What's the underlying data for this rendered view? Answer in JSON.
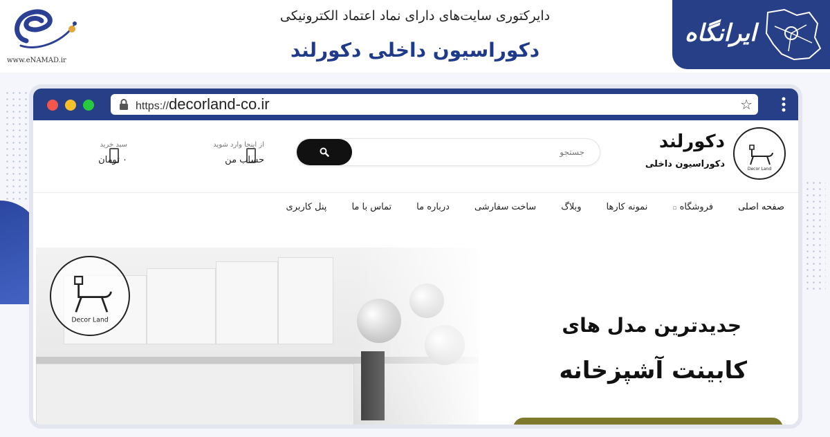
{
  "banner": {
    "enamad_url": "www.eNAMAD.ir",
    "directory_title": "دایرکتوری سایت‌های دارای نماد اعتماد الکترونیکی",
    "site_title": "دکوراسیون داخلی دکورلند",
    "irangah_label": "ایرانگاه"
  },
  "browser": {
    "url_protocol": "https://",
    "url_domain": "decorland-co.ir"
  },
  "header": {
    "brand_name": "دکورلند",
    "brand_subtitle": "دکوراسیون داخلی",
    "logo_text": "Decor Land",
    "search_placeholder": "جستجو",
    "account_small": "از اینجا وارد شوید",
    "account_main": "حساب من",
    "cart_small": "سبد خرید",
    "cart_main": "۰ تومان"
  },
  "nav": {
    "items": [
      "صفحه اصلی",
      "فروشگاه",
      "نمونه کارها",
      "وبلاگ",
      "ساخت سفارشی",
      "درباره ما",
      "تماس با ما",
      "پنل کاربری"
    ]
  },
  "hero": {
    "logo_text": "Decor Land",
    "line1": "جدیدترین مدل های",
    "line2": "کابینت آشپزخانه"
  },
  "colors": {
    "brand_blue": "#273f86",
    "hero_button": "#7d7a2e"
  }
}
